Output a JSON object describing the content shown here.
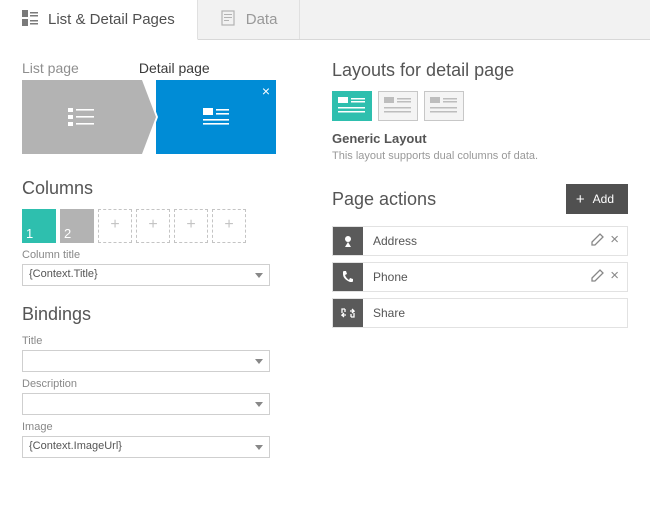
{
  "tabs": {
    "list_detail": "List & Detail Pages",
    "data": "Data"
  },
  "subtabs": {
    "list": "List page",
    "detail": "Detail page"
  },
  "columns": {
    "heading": "Columns",
    "chips": [
      "1",
      "2"
    ],
    "column_title_label": "Column title",
    "column_title_value": "{Context.Title}"
  },
  "bindings": {
    "heading": "Bindings",
    "title_label": "Title",
    "title_value": "",
    "description_label": "Description",
    "description_value": "",
    "image_label": "Image",
    "image_value": "{Context.ImageUrl}"
  },
  "layouts": {
    "heading": "Layouts for detail page",
    "name": "Generic Layout",
    "description": "This layout supports dual columns of data."
  },
  "page_actions": {
    "heading": "Page actions",
    "add_label": "Add",
    "items": [
      {
        "label": "Address"
      },
      {
        "label": "Phone"
      },
      {
        "label": "Share"
      }
    ]
  }
}
